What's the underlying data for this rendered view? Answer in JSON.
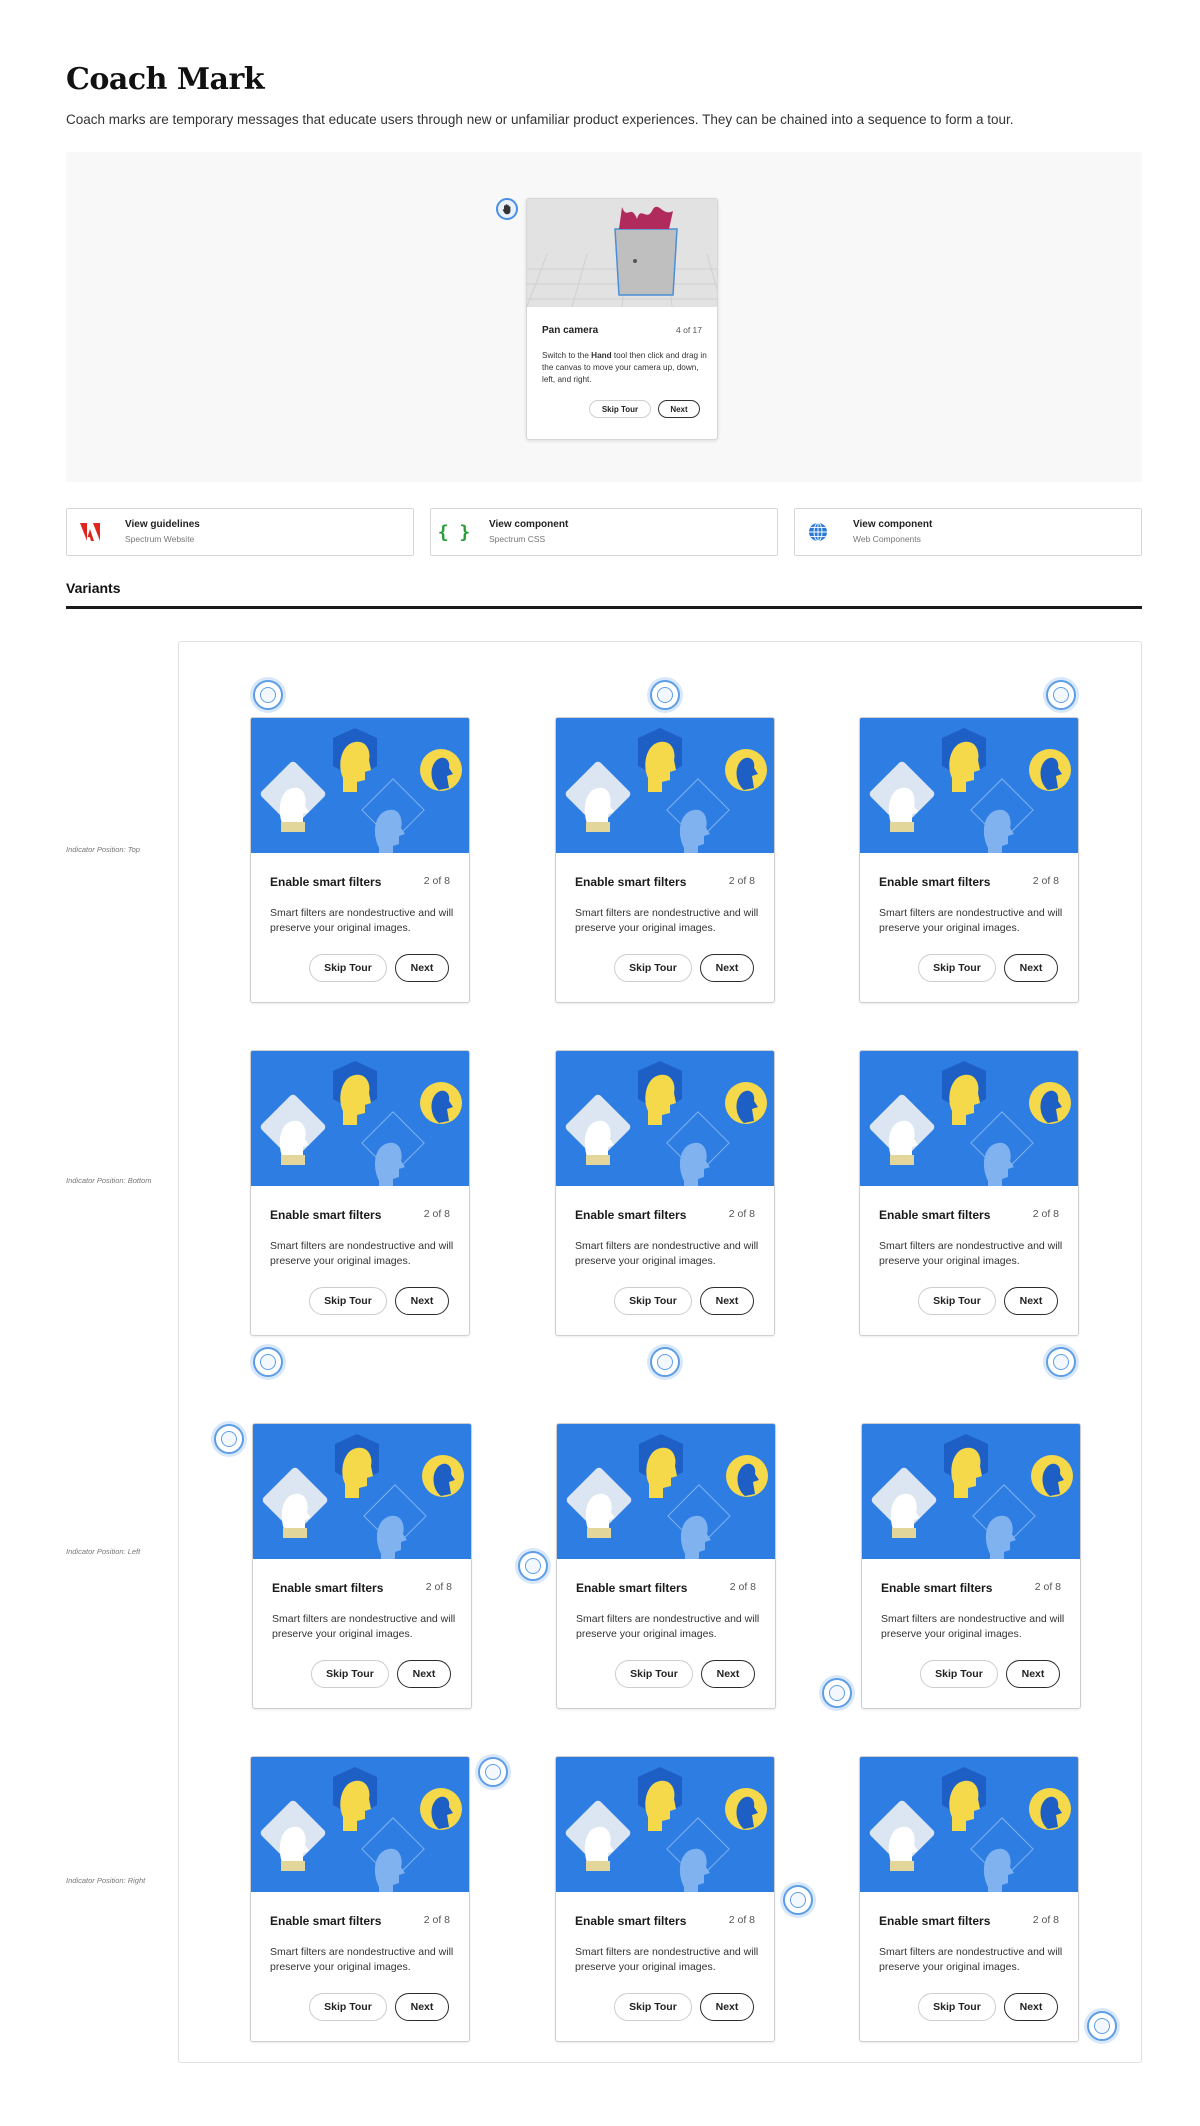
{
  "page": {
    "title": "Coach Mark",
    "description": "Coach marks are temporary messages that educate users through new or unfamiliar product experiences. They can be chained into a sequence to form a tour."
  },
  "hero": {
    "indicator_icon": "hand-icon",
    "card": {
      "title": "Pan camera",
      "step": "4 of 17",
      "body_before": "Switch to the ",
      "body_bold": "Hand",
      "body_after": " tool then click and drag in the canvas to move your camera up, down, left, and right.",
      "skip_label": "Skip Tour",
      "next_label": "Next"
    }
  },
  "links": [
    {
      "title": "View guidelines",
      "subtitle": "Spectrum Website",
      "icon": "adobe-logo-icon",
      "color": "#e0261c"
    },
    {
      "title": "View component",
      "subtitle": "Spectrum CSS",
      "icon": "curly-braces-icon",
      "color": "#2a9d3a"
    },
    {
      "title": "View component",
      "subtitle": "Web Components",
      "icon": "globe-icon",
      "color": "#2c7ad6"
    }
  ],
  "variants": {
    "heading": "Variants",
    "rows": [
      {
        "label": "Indicator Position: Top"
      },
      {
        "label": "Indicator Position: Bottom"
      },
      {
        "label": "Indicator Position: Left"
      },
      {
        "label": "Indicator Position: Right"
      }
    ],
    "card": {
      "title": "Enable smart filters",
      "step": "2 of 8",
      "body": "Smart filters are nondestructive and will preserve your original images.",
      "skip_label": "Skip Tour",
      "next_label": "Next"
    }
  },
  "colors": {
    "accent": "#2e7de3",
    "illustration_yellow": "#f6d94a",
    "indicator": "#5e9ee6"
  }
}
